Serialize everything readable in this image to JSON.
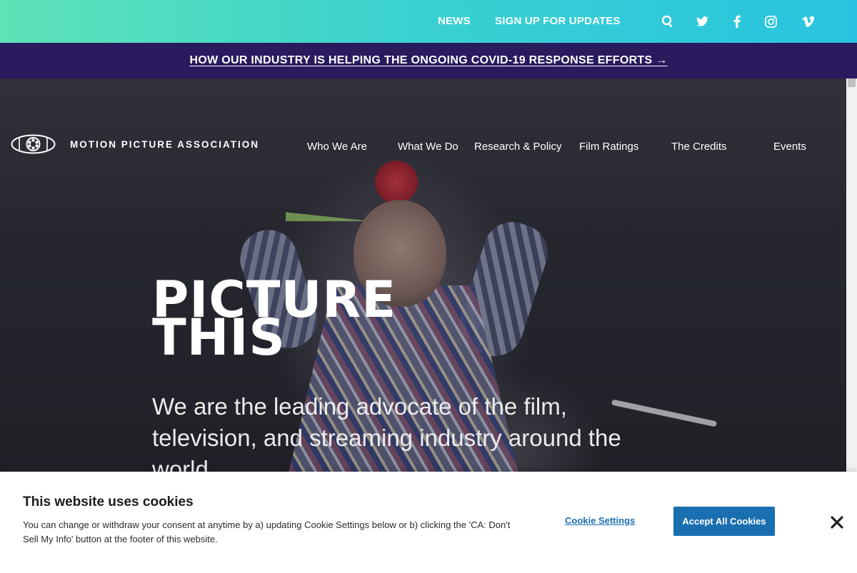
{
  "topbar": {
    "news_label": "NEWS",
    "signup_label": "SIGN UP FOR UPDATES",
    "icons": [
      "search-icon",
      "twitter-icon",
      "facebook-icon",
      "instagram-icon",
      "vimeo-icon"
    ]
  },
  "banner": {
    "text": "HOW OUR INDUSTRY IS HELPING THE ONGOING COVID-19 RESPONSE EFFORTS →"
  },
  "brand": {
    "name": "MOTION PICTURE ASSOCIATION"
  },
  "nav": {
    "items": [
      {
        "label": "Who We Are"
      },
      {
        "label": "What We Do"
      },
      {
        "label": "Research & Policy"
      },
      {
        "label": "Film Ratings"
      },
      {
        "label": "The Credits"
      },
      {
        "label": "Events"
      }
    ]
  },
  "hero": {
    "title_line1": "PICTURE",
    "title_line2": "THIS",
    "subtitle": "We are the leading advocate of the film, television, and streaming industry around the world."
  },
  "cookie": {
    "title": "This website uses cookies",
    "text": "You can change or withdraw your consent at anytime by a) updating Cookie Settings below or b) clicking the 'CA: Don't Sell My Info' button at the footer of this website.",
    "settings_label": "Cookie Settings",
    "accept_label": "Accept All Cookies"
  },
  "colors": {
    "banner_bg": "#2a1a5e",
    "accent_blue": "#1a6fb0",
    "topbar_start": "#5ee3b6",
    "topbar_end": "#28c3e0"
  }
}
